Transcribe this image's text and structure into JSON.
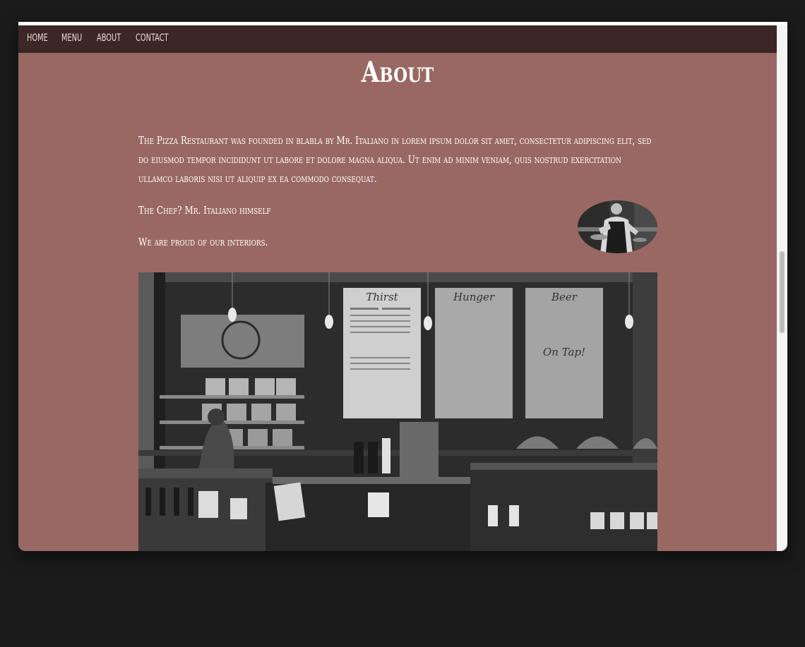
{
  "nav": {
    "items": [
      {
        "label": "home"
      },
      {
        "label": "menu"
      },
      {
        "label": "about"
      },
      {
        "label": "contact"
      }
    ]
  },
  "page": {
    "title": "About"
  },
  "about": {
    "intro": "The Pizza Restaurant was founded in blabla by Mr. Italiano in lorem ipsum dolor sit amet, consectetur adipiscing elit, sed do eiusmod tempor incididunt ut labore et dolore magna aliqua. Ut enim ad minim veniam, quis nostrud exercitation ullamco laboris nisi ut aliquip ex ea commodo consequat.",
    "chef_line": "The Chef? Mr. Italiano himself",
    "interiors_line": "We are proud of our interiors."
  },
  "board": {
    "thirst": "Thirst",
    "hunger": "Hunger",
    "beer": "Beer",
    "on_tap": "On Tap!"
  },
  "colors": {
    "background": "#9a6863",
    "navbar": "#3b2725",
    "text": "#ffffff"
  }
}
